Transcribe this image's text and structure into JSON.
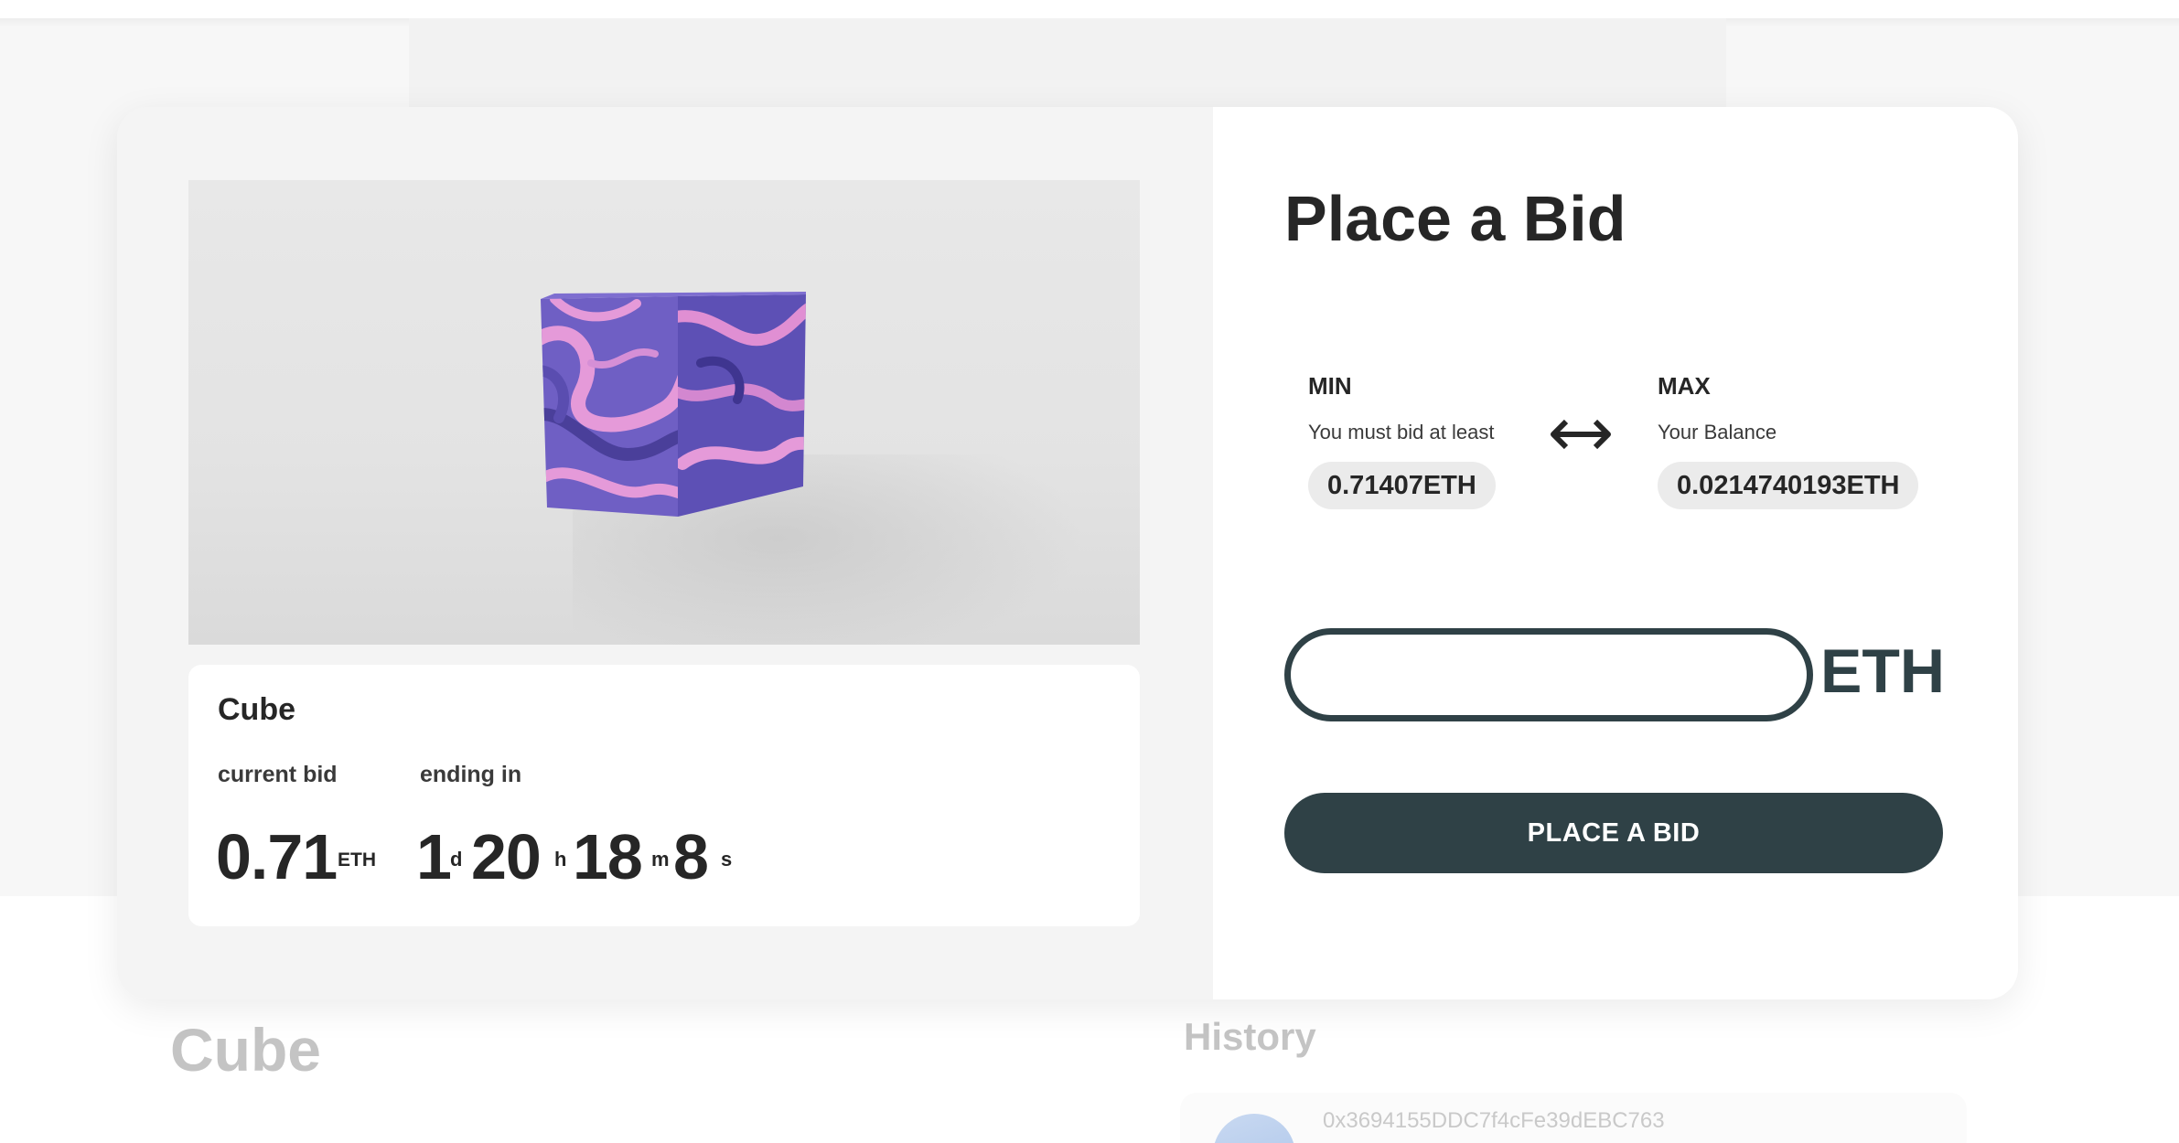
{
  "background": {
    "page_title": "Cube",
    "history_title": "History",
    "history_items": [
      {
        "address": "0x3694155DDC7f4cFe39dEBC763"
      }
    ]
  },
  "item": {
    "title": "Cube",
    "current_bid_label": "current bid",
    "current_bid_value": "0.71",
    "current_bid_unit": "ETH",
    "ending_in_label": "ending in",
    "countdown": {
      "days": "1",
      "days_unit": "d",
      "hours": "20",
      "hours_unit": "h",
      "minutes": "18",
      "minutes_unit": "m",
      "seconds": "8",
      "seconds_unit": "s"
    },
    "image_icon": "purple-marbled-cube"
  },
  "bid_panel": {
    "heading": "Place a Bid",
    "min": {
      "label": "MIN",
      "sublabel": "You must bid at least",
      "value": "0.71407ETH"
    },
    "max": {
      "label": "MAX",
      "sublabel": "Your Balance",
      "value": "0.0214740193ETH"
    },
    "range_icon": "left-right-arrow-icon",
    "input": {
      "value": "",
      "placeholder": "",
      "suffix": "ETH"
    },
    "submit_label": "PLACE A BID"
  },
  "colors": {
    "primary": "#2f4146",
    "text": "#262626",
    "pill_bg": "#ebebeb",
    "cube_purple": "#6f5fc4",
    "cube_pink": "#e59ad9"
  }
}
